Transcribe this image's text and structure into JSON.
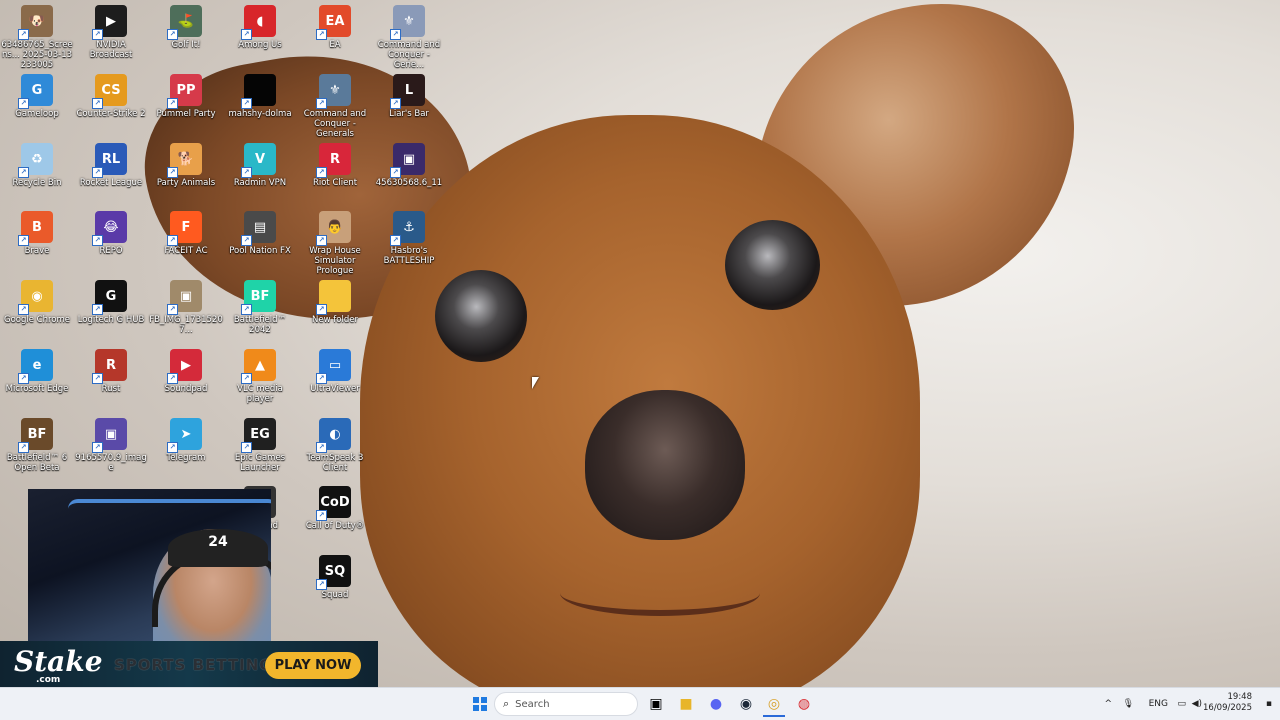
{
  "desktop": {
    "icons": [
      {
        "label": "63486765_Screens...\n2025-03-13 233005",
        "glyph": "🐶",
        "bg": "#8a6a4a",
        "col": 0,
        "row": 0
      },
      {
        "label": "Gameloop",
        "glyph": "G",
        "bg": "#2f8ad8",
        "col": 0,
        "row": 1
      },
      {
        "label": "Recycle Bin",
        "glyph": "♻",
        "bg": "#9ec8e8",
        "col": 0,
        "row": 2
      },
      {
        "label": "Brave",
        "glyph": "B",
        "bg": "#ea5a2a",
        "col": 0,
        "row": 3
      },
      {
        "label": "Google Chrome",
        "glyph": "◉",
        "bg": "#e9b531",
        "col": 0,
        "row": 4
      },
      {
        "label": "Microsoft Edge",
        "glyph": "e",
        "bg": "#1f8fd8",
        "col": 0,
        "row": 5
      },
      {
        "label": "Battlefield™ 6 Open Beta",
        "glyph": "BF",
        "bg": "#6a4a2a",
        "col": 0,
        "row": 6
      },
      {
        "label": "NVIDIA Broadcast",
        "glyph": "▶",
        "bg": "#1d1d1d",
        "col": 1,
        "row": 0
      },
      {
        "label": "Counter-Strike 2",
        "glyph": "CS",
        "bg": "#e59a1e",
        "col": 1,
        "row": 1
      },
      {
        "label": "Rocket League",
        "glyph": "RL",
        "bg": "#2a5ab8",
        "col": 1,
        "row": 2
      },
      {
        "label": "REPO",
        "glyph": "😂",
        "bg": "#5a3aa8",
        "col": 1,
        "row": 3
      },
      {
        "label": "Logitech G HUB",
        "glyph": "G",
        "bg": "#111111",
        "col": 1,
        "row": 4
      },
      {
        "label": "Rust",
        "glyph": "R",
        "bg": "#b5372a",
        "col": 1,
        "row": 5
      },
      {
        "label": "9165570.9_image",
        "glyph": "▣",
        "bg": "#5a4aa8",
        "col": 1,
        "row": 6
      },
      {
        "label": "Golf It!",
        "glyph": "⛳",
        "bg": "#4e6e5a",
        "col": 2,
        "row": 0
      },
      {
        "label": "Pummel Party",
        "glyph": "PP",
        "bg": "#d63a4a",
        "col": 2,
        "row": 1
      },
      {
        "label": "Party Animals",
        "glyph": "🐕",
        "bg": "#e8a04a",
        "col": 2,
        "row": 2
      },
      {
        "label": "FACEIT AC",
        "glyph": "F",
        "bg": "#ff5a1f",
        "col": 2,
        "row": 3
      },
      {
        "label": "FB_IMG_17315207...",
        "glyph": "▣",
        "bg": "#a08a6a",
        "col": 2,
        "row": 4
      },
      {
        "label": "Soundpad",
        "glyph": "▶",
        "bg": "#d42a3a",
        "col": 2,
        "row": 5
      },
      {
        "label": "Telegram",
        "glyph": "➤",
        "bg": "#2ea3dd",
        "col": 2,
        "row": 6
      },
      {
        "label": "Among Us",
        "glyph": "◖",
        "bg": "#d8262a",
        "col": 3,
        "row": 0
      },
      {
        "label": "mahshy-dolma",
        "glyph": "",
        "bg": "#050505",
        "col": 3,
        "row": 1
      },
      {
        "label": "Radmin VPN",
        "glyph": "V",
        "bg": "#2ab8c8",
        "col": 3,
        "row": 2
      },
      {
        "label": "Pool Nation FX",
        "glyph": "▤",
        "bg": "#4a4a4a",
        "col": 3,
        "row": 3
      },
      {
        "label": "Battlefield™ 2042",
        "glyph": "BF",
        "bg": "#1fd3a8",
        "col": 3,
        "row": 4
      },
      {
        "label": "VLC media player",
        "glyph": "▲",
        "bg": "#f08a1a",
        "col": 3,
        "row": 5
      },
      {
        "label": "Epic Games Launcher",
        "glyph": "EG",
        "bg": "#202020",
        "col": 3,
        "row": 6
      },
      {
        "label": "Playland",
        "glyph": "▣",
        "bg": "#333",
        "col": 3,
        "row": 7
      },
      {
        "label": "EA",
        "glyph": "EA",
        "bg": "#e24a2a",
        "col": 4,
        "row": 0
      },
      {
        "label": "Command and Conquer - Generals",
        "glyph": "⚜",
        "bg": "#5a7a9a",
        "col": 4,
        "row": 1
      },
      {
        "label": "Riot Client",
        "glyph": "R",
        "bg": "#d8263a",
        "col": 4,
        "row": 2
      },
      {
        "label": "Wrap House Simulator Prologue",
        "glyph": "👨",
        "bg": "#c8a07a",
        "col": 4,
        "row": 3
      },
      {
        "label": "New folder",
        "glyph": "",
        "bg": "#f4c43a",
        "col": 4,
        "row": 4
      },
      {
        "label": "UltraViewer",
        "glyph": "▭",
        "bg": "#2a7ad8",
        "col": 4,
        "row": 5
      },
      {
        "label": "TeamSpeak 3 Client",
        "glyph": "◐",
        "bg": "#2a6ab8",
        "col": 4,
        "row": 6
      },
      {
        "label": "Call of Duty®",
        "glyph": "CoD",
        "bg": "#111",
        "col": 4,
        "row": 7
      },
      {
        "label": "Squad",
        "glyph": "SQ",
        "bg": "#111",
        "col": 4,
        "row": 8
      },
      {
        "label": "Command and Conquer - Gene...",
        "glyph": "⚜",
        "bg": "#8a9ab8",
        "col": 5,
        "row": 0
      },
      {
        "label": "Liar's Bar",
        "glyph": "L",
        "bg": "#2a1a1a",
        "col": 5,
        "row": 1
      },
      {
        "label": "45630568.6_11",
        "glyph": "▣",
        "bg": "#3a2a6a",
        "col": 5,
        "row": 2
      },
      {
        "label": "Hasbro's BATTLESHIP",
        "glyph": "⚓",
        "bg": "#2a5a8a",
        "col": 5,
        "row": 3
      }
    ]
  },
  "overlay": {
    "banner": {
      "logo": "Stake",
      "logo_sub": ".com",
      "tagline": "SPORTS BETTING",
      "cta": "PLAY NOW"
    },
    "webcam": {
      "cap_text": "24"
    }
  },
  "taskbar": {
    "search_placeholder": "Search",
    "apps": [
      {
        "name": "file-explorer"
      },
      {
        "name": "discord"
      },
      {
        "name": "steam"
      },
      {
        "name": "chrome"
      },
      {
        "name": "other"
      }
    ],
    "tray": {
      "lang": "ENG",
      "time": "19:48",
      "date": "16/09/2025"
    }
  }
}
